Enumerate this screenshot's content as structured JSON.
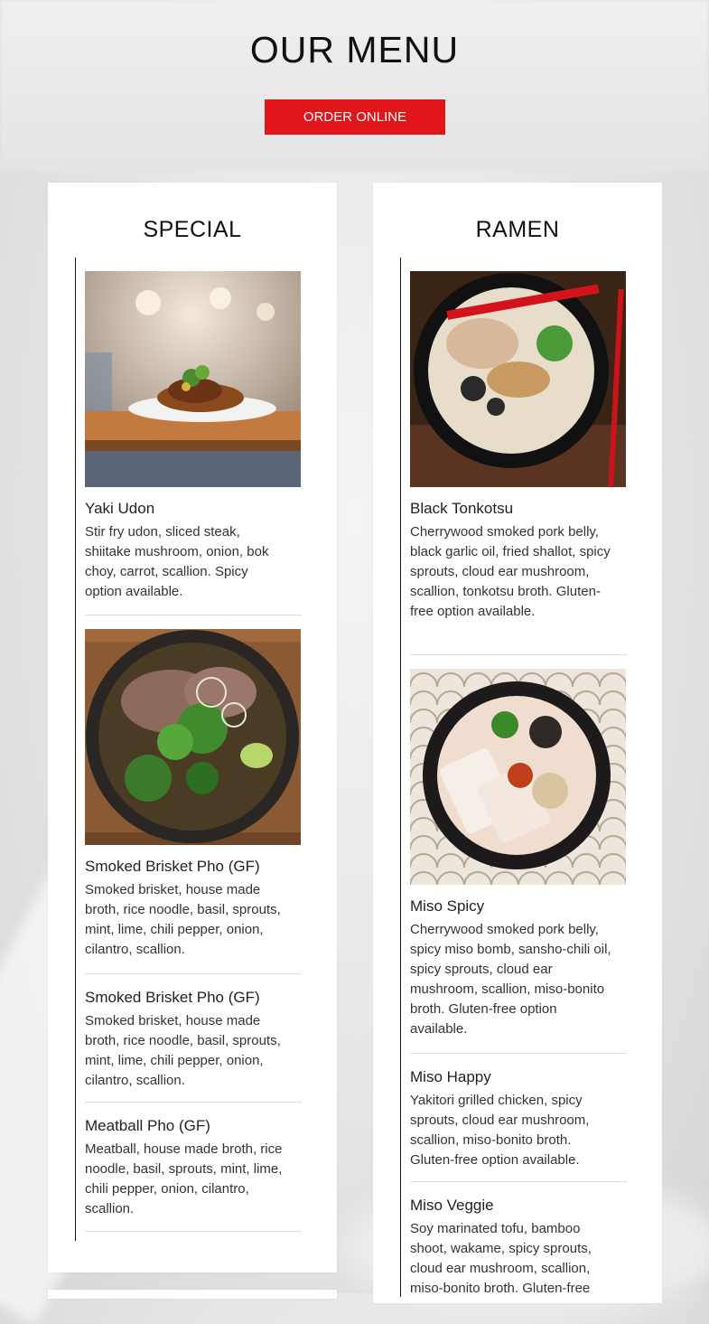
{
  "header": {
    "title": "OUR MENU",
    "order_label": "ORDER ONLINE"
  },
  "colors": {
    "accent": "#e0161b"
  },
  "special": {
    "title": "SPECIAL",
    "items": [
      {
        "name": "Yaki Udon",
        "desc": "Stir fry udon, sliced steak, shiitake mushroom, onion, bok choy, carrot, scallion. Spicy option available."
      },
      {
        "name": "Smoked Brisket Pho (GF)",
        "desc": "Smoked brisket, house made broth, rice noodle, basil, sprouts, mint, lime, chili pepper, onion, cilantro, scallion."
      },
      {
        "name": "Smoked Brisket Pho (GF)",
        "desc": "Smoked brisket, house made broth, rice noodle, basil, sprouts, mint, lime, chili pepper, onion, cilantro, scallion."
      },
      {
        "name": "Meatball Pho (GF)",
        "desc": "Meatball, house made broth, rice noodle, basil, sprouts, mint, lime, chili pepper, onion, cilantro, scallion."
      }
    ]
  },
  "ramen": {
    "title": "RAMEN",
    "items": [
      {
        "name": "Black Tonkotsu",
        "desc": "Cherrywood smoked pork belly, black garlic oil, fried shallot, spicy sprouts, cloud ear mushroom, scallion, tonkotsu broth. Gluten-free option available."
      },
      {
        "name": "Miso Spicy",
        "desc": "Cherrywood smoked pork belly, spicy miso bomb, sansho-chili oil, spicy sprouts, cloud ear mushroom, scallion, miso-bonito broth. Gluten-free option available."
      },
      {
        "name": "Miso Happy",
        "desc": "Yakitori grilled chicken, spicy sprouts, cloud ear mushroom, scallion, miso-bonito broth. Gluten-free option available."
      },
      {
        "name": "Miso Veggie",
        "desc": "Soy marinated tofu, bamboo shoot, wakame, spicy sprouts, cloud ear mushroom, scallion, miso-bonito broth. Gluten-free"
      }
    ]
  }
}
